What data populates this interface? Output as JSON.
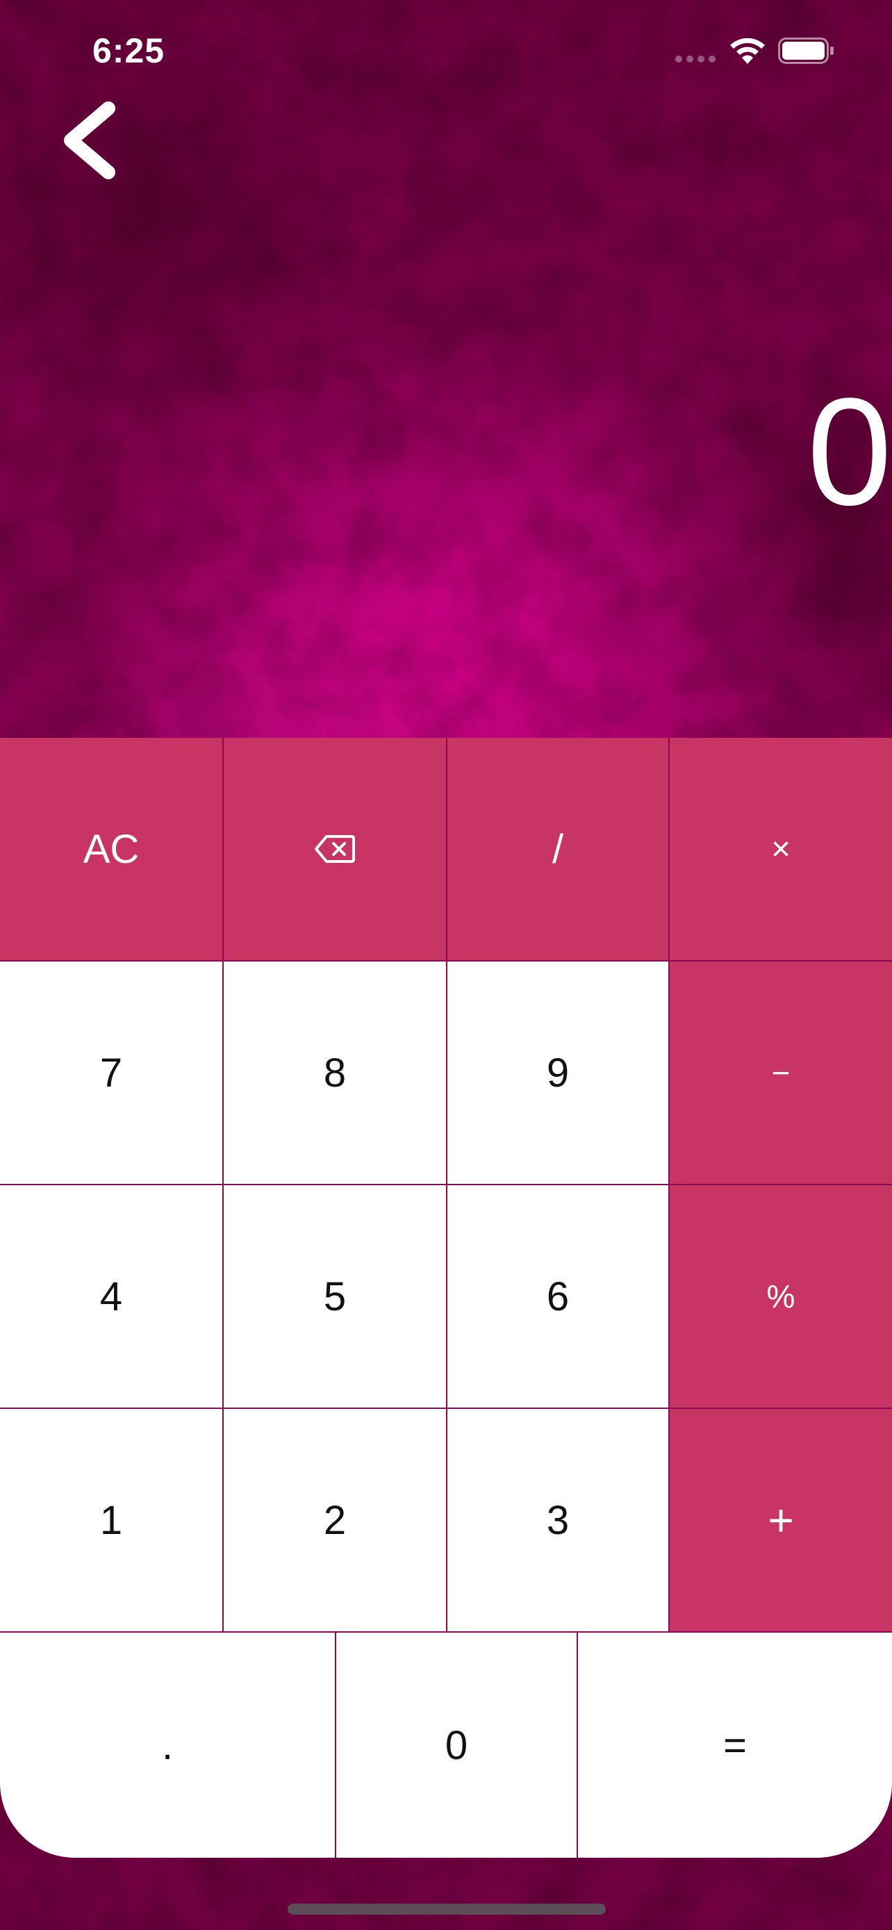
{
  "status_bar": {
    "time": "6:25",
    "signal_icon": "cellular-signal-icon",
    "wifi_icon": "wifi-icon",
    "battery_icon": "battery-icon"
  },
  "navigation": {
    "back_icon": "chevron-left-icon"
  },
  "display": {
    "value": "0"
  },
  "colors": {
    "operator_key": "#c83463",
    "digit_key": "#ffffff",
    "key_border": "#8a0a52",
    "background": "#9a005e",
    "display_text": "#ffffff"
  },
  "keypad": {
    "row1": {
      "clear": "AC",
      "backspace_icon": "backspace-icon",
      "divide": "/",
      "multiply": "×"
    },
    "row2": {
      "seven": "7",
      "eight": "8",
      "nine": "9",
      "minus": "−"
    },
    "row3": {
      "four": "4",
      "five": "5",
      "six": "6",
      "percent": "%"
    },
    "row4": {
      "one": "1",
      "two": "2",
      "three": "3",
      "plus": "+"
    },
    "row5": {
      "decimal": ".",
      "zero": "0",
      "equals": "="
    }
  }
}
